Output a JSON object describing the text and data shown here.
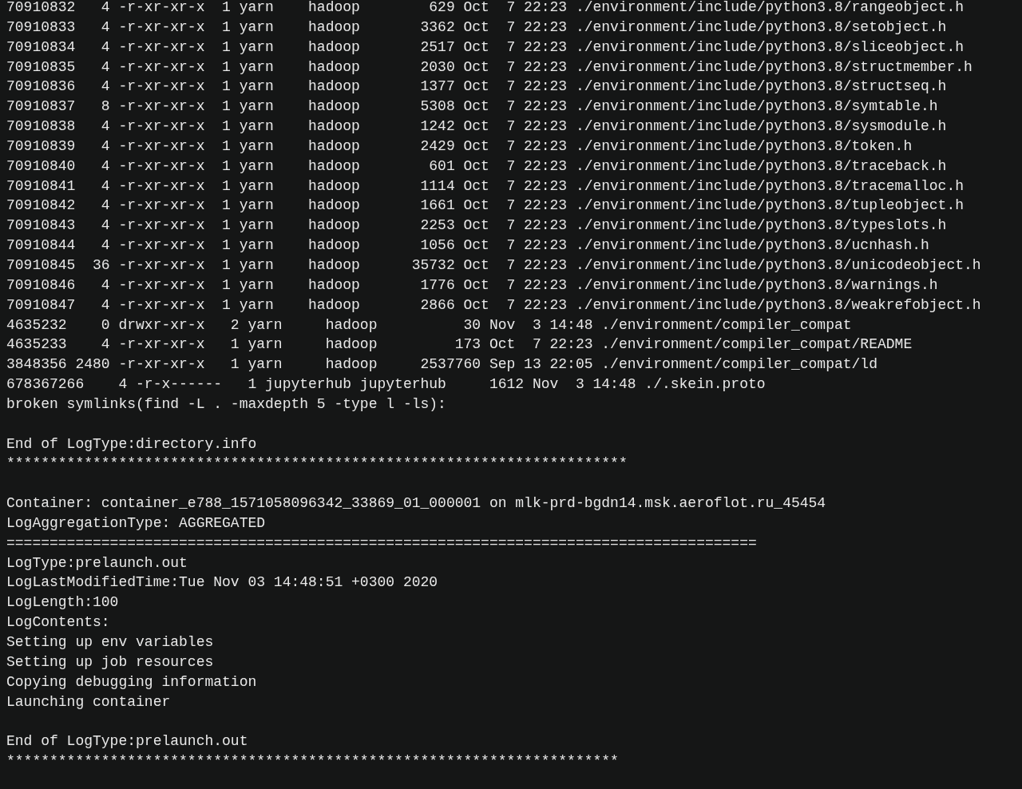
{
  "terminal": {
    "lines": [
      {
        "kind": "text",
        "text": "70910832   4 -r-xr-xr-x  1 yarn    hadoop        629 Oct  7 22:23 ./environment/include/python3.8/rangeobject.h"
      },
      {
        "kind": "text",
        "text": "70910833   4 -r-xr-xr-x  1 yarn    hadoop       3362 Oct  7 22:23 ./environment/include/python3.8/setobject.h"
      },
      {
        "kind": "text",
        "text": "70910834   4 -r-xr-xr-x  1 yarn    hadoop       2517 Oct  7 22:23 ./environment/include/python3.8/sliceobject.h"
      },
      {
        "kind": "text",
        "text": "70910835   4 -r-xr-xr-x  1 yarn    hadoop       2030 Oct  7 22:23 ./environment/include/python3.8/structmember.h"
      },
      {
        "kind": "text",
        "text": "70910836   4 -r-xr-xr-x  1 yarn    hadoop       1377 Oct  7 22:23 ./environment/include/python3.8/structseq.h"
      },
      {
        "kind": "text",
        "text": "70910837   8 -r-xr-xr-x  1 yarn    hadoop       5308 Oct  7 22:23 ./environment/include/python3.8/symtable.h"
      },
      {
        "kind": "text",
        "text": "70910838   4 -r-xr-xr-x  1 yarn    hadoop       1242 Oct  7 22:23 ./environment/include/python3.8/sysmodule.h"
      },
      {
        "kind": "text",
        "text": "70910839   4 -r-xr-xr-x  1 yarn    hadoop       2429 Oct  7 22:23 ./environment/include/python3.8/token.h"
      },
      {
        "kind": "text",
        "text": "70910840   4 -r-xr-xr-x  1 yarn    hadoop        601 Oct  7 22:23 ./environment/include/python3.8/traceback.h"
      },
      {
        "kind": "text",
        "text": "70910841   4 -r-xr-xr-x  1 yarn    hadoop       1114 Oct  7 22:23 ./environment/include/python3.8/tracemalloc.h"
      },
      {
        "kind": "text",
        "text": "70910842   4 -r-xr-xr-x  1 yarn    hadoop       1661 Oct  7 22:23 ./environment/include/python3.8/tupleobject.h"
      },
      {
        "kind": "text",
        "text": "70910843   4 -r-xr-xr-x  1 yarn    hadoop       2253 Oct  7 22:23 ./environment/include/python3.8/typeslots.h"
      },
      {
        "kind": "text",
        "text": "70910844   4 -r-xr-xr-x  1 yarn    hadoop       1056 Oct  7 22:23 ./environment/include/python3.8/ucnhash.h"
      },
      {
        "kind": "text",
        "text": "70910845  36 -r-xr-xr-x  1 yarn    hadoop      35732 Oct  7 22:23 ./environment/include/python3.8/unicodeobject.h"
      },
      {
        "kind": "text",
        "text": "70910846   4 -r-xr-xr-x  1 yarn    hadoop       1776 Oct  7 22:23 ./environment/include/python3.8/warnings.h"
      },
      {
        "kind": "text",
        "text": "70910847   4 -r-xr-xr-x  1 yarn    hadoop       2866 Oct  7 22:23 ./environment/include/python3.8/weakrefobject.h"
      },
      {
        "kind": "text",
        "text": "4635232    0 drwxr-xr-x   2 yarn     hadoop          30 Nov  3 14:48 ./environment/compiler_compat"
      },
      {
        "kind": "text",
        "text": "4635233    4 -r-xr-xr-x   1 yarn     hadoop         173 Oct  7 22:23 ./environment/compiler_compat/README"
      },
      {
        "kind": "text",
        "text": "3848356 2480 -r-xr-xr-x   1 yarn     hadoop     2537760 Sep 13 22:05 ./environment/compiler_compat/ld"
      },
      {
        "kind": "text",
        "text": "678367266    4 -r-x------   1 jupyterhub jupyterhub     1612 Nov  3 14:48 ./.skein.proto"
      },
      {
        "kind": "text",
        "text": "broken symlinks(find -L . -maxdepth 5 -type l -ls):"
      },
      {
        "kind": "blank"
      },
      {
        "kind": "text",
        "text": "End of LogType:directory.info"
      },
      {
        "kind": "text",
        "text": "************************************************************************"
      },
      {
        "kind": "blank"
      },
      {
        "kind": "text",
        "text": "Container: container_e788_1571058096342_33869_01_000001 on mlk-prd-bgdn14.msk.aeroflot.ru_45454"
      },
      {
        "kind": "text",
        "text": "LogAggregationType: AGGREGATED"
      },
      {
        "kind": "text",
        "text": "======================================================================================="
      },
      {
        "kind": "text",
        "text": "LogType:prelaunch.out"
      },
      {
        "kind": "text",
        "text": "LogLastModifiedTime:Tue Nov 03 14:48:51 +0300 2020"
      },
      {
        "kind": "text",
        "text": "LogLength:100"
      },
      {
        "kind": "text",
        "text": "LogContents:"
      },
      {
        "kind": "text",
        "text": "Setting up env variables"
      },
      {
        "kind": "text",
        "text": "Setting up job resources"
      },
      {
        "kind": "text",
        "text": "Copying debugging information"
      },
      {
        "kind": "text",
        "text": "Launching container"
      },
      {
        "kind": "blank"
      },
      {
        "kind": "text",
        "text": "End of LogType:prelaunch.out"
      },
      {
        "kind": "text",
        "text": "***********************************************************************"
      }
    ]
  }
}
